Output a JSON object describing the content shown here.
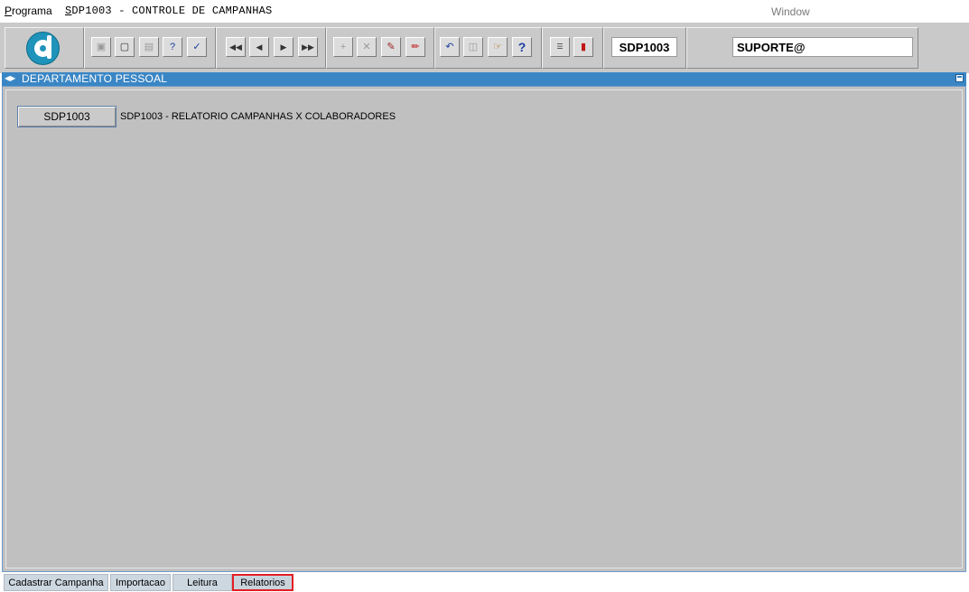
{
  "menubar": {
    "programa": "Programa",
    "title": "SDP1003 - CONTROLE DE CAMPANHAS",
    "window": "Window"
  },
  "toolbar": {
    "program_code": "SDP1003",
    "user": "SUPORTE@",
    "buttons": [
      "save-icon",
      "print-preview-icon",
      "print-icon",
      "query-icon",
      "execute-query-icon",
      "first-record-icon",
      "previous-record-icon",
      "next-record-icon",
      "last-record-icon",
      "insert-record-icon",
      "delete-record-icon",
      "edit-record-icon",
      "clear-icon",
      "undo-icon",
      "paste-icon",
      "point-icon",
      "help-icon",
      "menu-icon",
      "exit-icon"
    ]
  },
  "panel": {
    "title": "DEPARTAMENTO PESSOAL",
    "report_button": "SDP1003",
    "report_description": "SDP1003 - RELATORIO CAMPANHAS X COLABORADORES"
  },
  "tabs": [
    {
      "label": "Cadastrar Campanha"
    },
    {
      "label": "Importacao"
    },
    {
      "label": "Leitura"
    },
    {
      "label": "Relatorios",
      "active": true
    }
  ],
  "colors": {
    "panel_header": "#3a86c5",
    "panel_body": "#c0c0c0",
    "active_tab_border": "#e31e24"
  }
}
